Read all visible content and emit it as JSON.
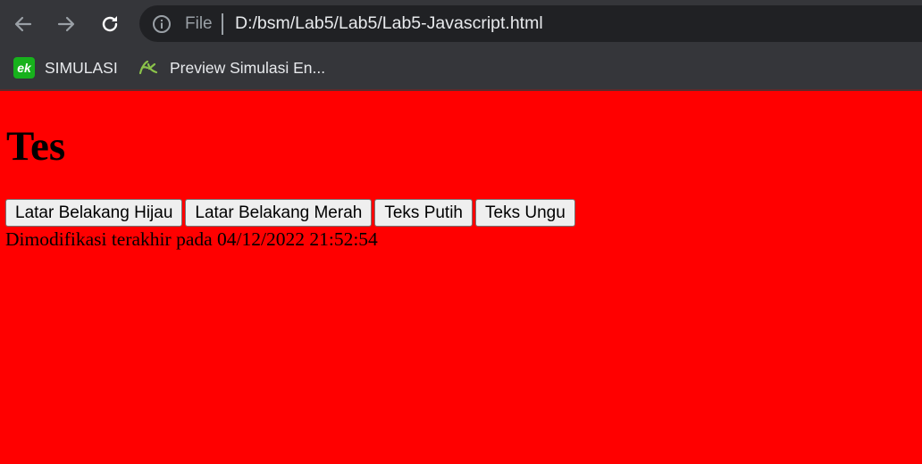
{
  "browser": {
    "address_bar": {
      "scheme_label": "File",
      "url": "D:/bsm/Lab5/Lab5/Lab5-Javascript.html"
    },
    "nav_icons": [
      "back-arrow-icon",
      "forward-arrow-icon",
      "reload-icon"
    ],
    "bookmarks": [
      {
        "label": "SIMULASI",
        "icon": "ek-logo-icon",
        "icon_color": "#17b11c"
      },
      {
        "label": "Preview Simulasi En...",
        "icon": "ek-leaf-icon",
        "icon_color": "#8bc34a"
      }
    ],
    "chrome_color": "#35363a"
  },
  "page": {
    "background_color": "#ff0000",
    "heading": "Tes",
    "buttons": [
      {
        "label": "Latar Belakang Hijau"
      },
      {
        "label": "Latar Belakang Merah"
      },
      {
        "label": "Teks Putih"
      },
      {
        "label": "Teks Ungu"
      }
    ],
    "last_modified_text": "Dimodifikasi terakhir pada 04/12/2022 21:52:54"
  }
}
